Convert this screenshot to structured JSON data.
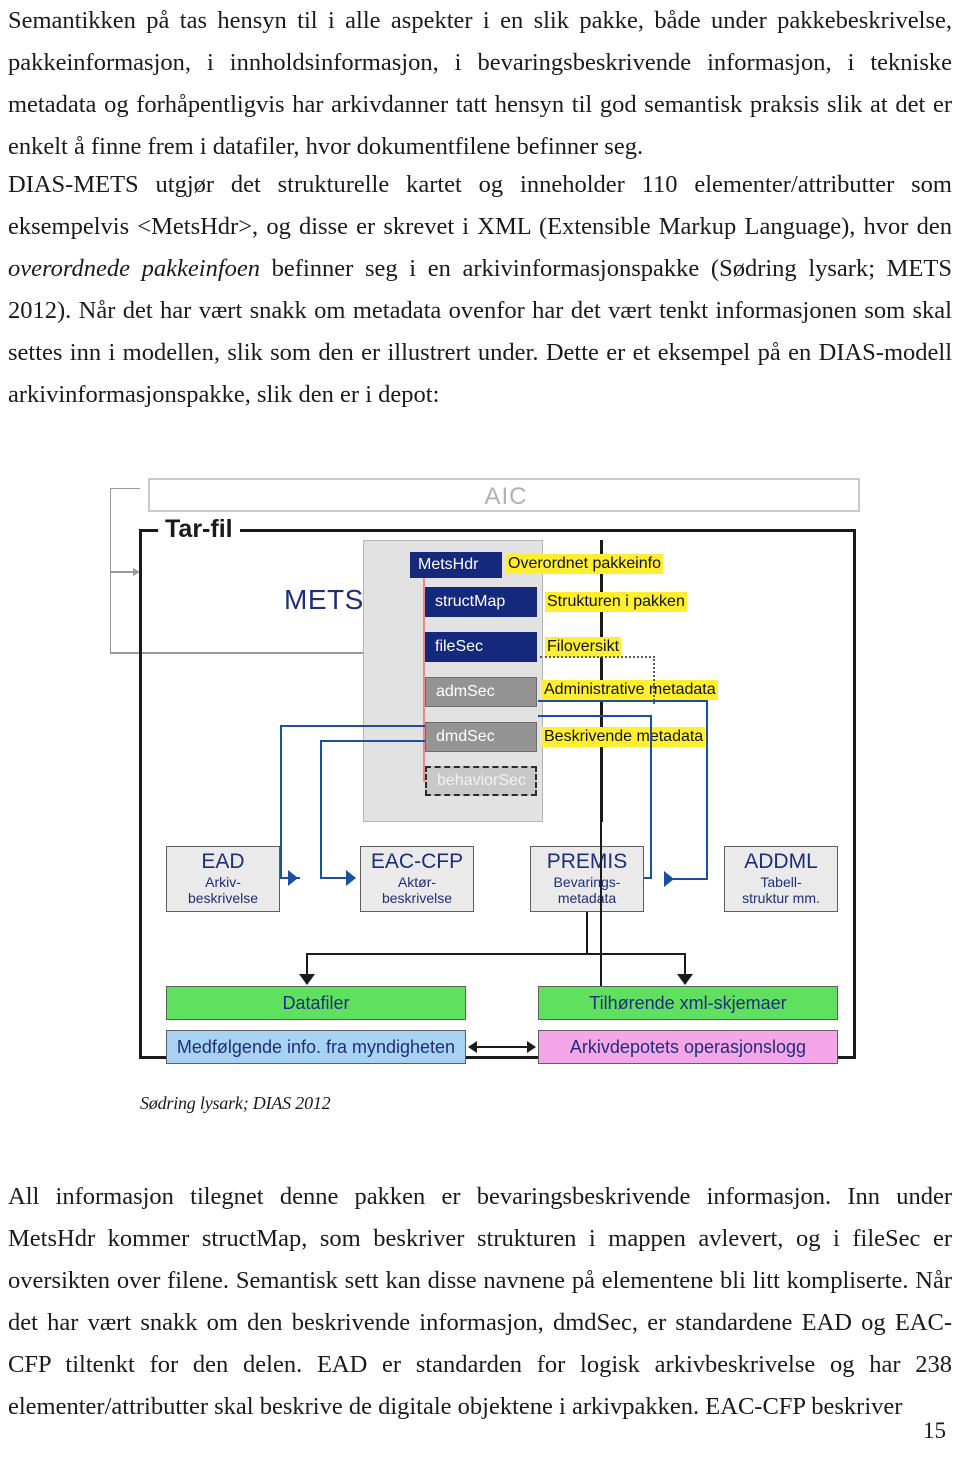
{
  "document": {
    "paragraph_1": "Semantikken på tas hensyn til i alle aspekter i en slik pakke, både under pakkebeskrivelse, pakkeinformasjon, i innholdsinformasjon, i bevaringsbeskrivende informasjon, i tekniske metadata og forhåpentligvis har arkivdanner tatt hensyn til god semantisk praksis slik at det er enkelt å finne frem i datafiler, hvor dokumentfilene befinner seg.",
    "paragraph_2_part_a": "DIAS-METS utgjør det strukturelle kartet og inneholder 110 elementer/attributter som eksempelvis <MetsHdr>, og disse er skrevet i XML (Extensible Markup Language), hvor den ",
    "paragraph_2_italic": "overordnede pakkeinfoen",
    "paragraph_2_part_b": " befinner seg i en arkivinformasjonspakke (Sødring lysark; METS 2012). Når det har vært snakk om metadata ovenfor har det vært tenkt informasjonen som skal settes inn i modellen, slik som den er illustrert under. Dette er et eksempel på en DIAS-modell arkivinformasjonspakke, slik den er i depot:",
    "figure_caption": "Sødring lysark; DIAS 2012",
    "paragraph_3": "All informasjon tilegnet denne pakken er bevaringsbeskrivende informasjon. Inn under MetsHdr kommer structMap, som beskriver strukturen i mappen avlevert, og i fileSec er oversikten over filene. Semantisk sett kan disse navnene på elementene bli litt kompliserte. Når det har vært snakk om den beskrivende informasjon, dmdSec, er standardene EAD og EAC-CFP tiltenkt for den delen. EAD er standarden for logisk arkivbeskrivelse og har 238 elementer/attributter skal beskrive de digitale objektene i arkivpakken. EAC-CFP beskriver",
    "page_number": "15"
  },
  "diagram": {
    "aic_label": "AIC",
    "tarfil_label": "Tar-fil",
    "mets_label": "METS",
    "mets_elements": [
      {
        "name": "MetsHdr",
        "style": "navy",
        "annotation": "Overordnet pakkeinfo"
      },
      {
        "name": "structMap",
        "style": "navy",
        "annotation": "Strukturen i pakken"
      },
      {
        "name": "fileSec",
        "style": "navy",
        "annotation": "Filoversikt"
      },
      {
        "name": "admSec",
        "style": "gray",
        "annotation": "Administrative metadata"
      },
      {
        "name": "dmdSec",
        "style": "gray",
        "annotation": "Beskrivende metadata"
      },
      {
        "name": "behaviorSec",
        "style": "dashed",
        "annotation": ""
      }
    ],
    "standards": [
      {
        "title": "EAD",
        "subtitle_line1": "Arkiv-",
        "subtitle_line2": "beskrivelse"
      },
      {
        "title": "EAC-CFP",
        "subtitle_line1": "Aktør-",
        "subtitle_line2": "beskrivelse"
      },
      {
        "title": "PREMIS",
        "subtitle_line1": "Bevarings-",
        "subtitle_line2": "metadata"
      },
      {
        "title": "ADDML",
        "subtitle_line1": "Tabell-",
        "subtitle_line2": "struktur mm."
      }
    ],
    "bottom_bars": [
      {
        "label": "Datafiler",
        "color": "#5fe05f"
      },
      {
        "label": "Tilhørende xml-skjemaer",
        "color": "#5fe05f"
      },
      {
        "label": "Medfølgende info. fra myndigheten",
        "color": "#a8d2f2"
      },
      {
        "label": "Arkivdepotets operasjonslogg",
        "color": "#f5a6e8"
      }
    ],
    "colors": {
      "navy_box": "#15297c",
      "gray_box": "#949494",
      "dashed_box": "#c8c8c8",
      "highlight": "#ffef30",
      "blue_connector": "#1b4fa0",
      "red_connector": "#e98a8a",
      "std_text": "#1f2e78"
    }
  }
}
